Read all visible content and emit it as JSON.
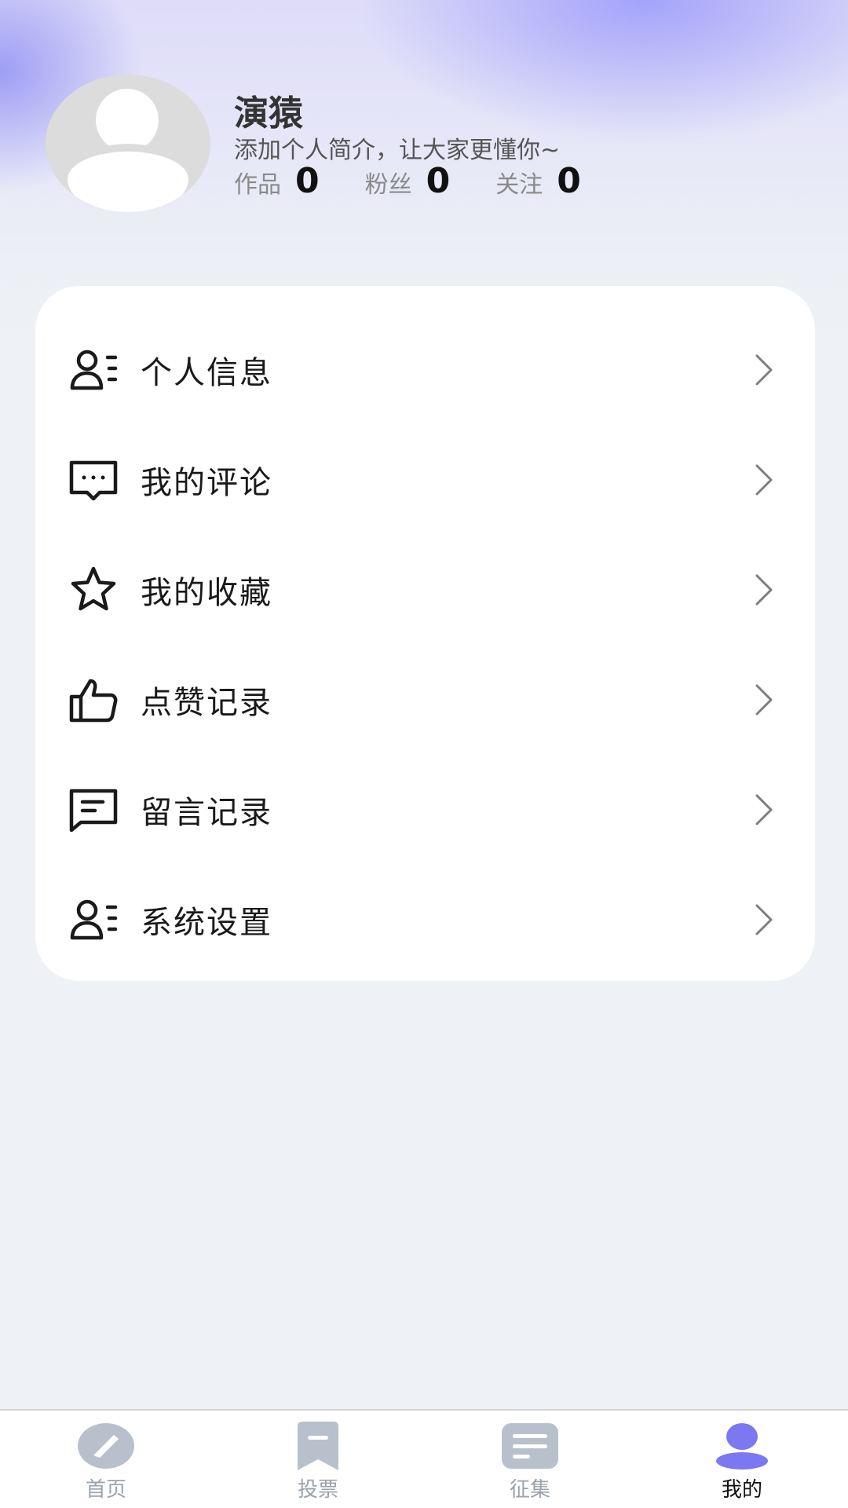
{
  "profile": {
    "name": "演猿",
    "bio": "添加个人简介，让大家更懂你~",
    "stats": [
      {
        "label": "作品",
        "value": "0"
      },
      {
        "label": "粉丝",
        "value": "0"
      },
      {
        "label": "关注",
        "value": "0"
      }
    ]
  },
  "menu": {
    "items": [
      {
        "label": "个人信息",
        "icon": "user-list-icon"
      },
      {
        "label": "我的评论",
        "icon": "comment-icon"
      },
      {
        "label": "我的收藏",
        "icon": "star-icon"
      },
      {
        "label": "点赞记录",
        "icon": "thumbs-up-icon"
      },
      {
        "label": "留言记录",
        "icon": "message-icon"
      },
      {
        "label": "系统设置",
        "icon": "user-list-icon"
      }
    ]
  },
  "nav": {
    "items": [
      {
        "label": "首页",
        "icon": "compass-icon",
        "active": false
      },
      {
        "label": "投票",
        "icon": "bookmark-icon",
        "active": false
      },
      {
        "label": "征集",
        "icon": "document-icon",
        "active": false
      },
      {
        "label": "我的",
        "icon": "user-icon",
        "active": true
      }
    ]
  },
  "colors": {
    "accent": "#7b78f2",
    "inactive_nav": "#b8c1cb",
    "background": "#eef1f5"
  }
}
